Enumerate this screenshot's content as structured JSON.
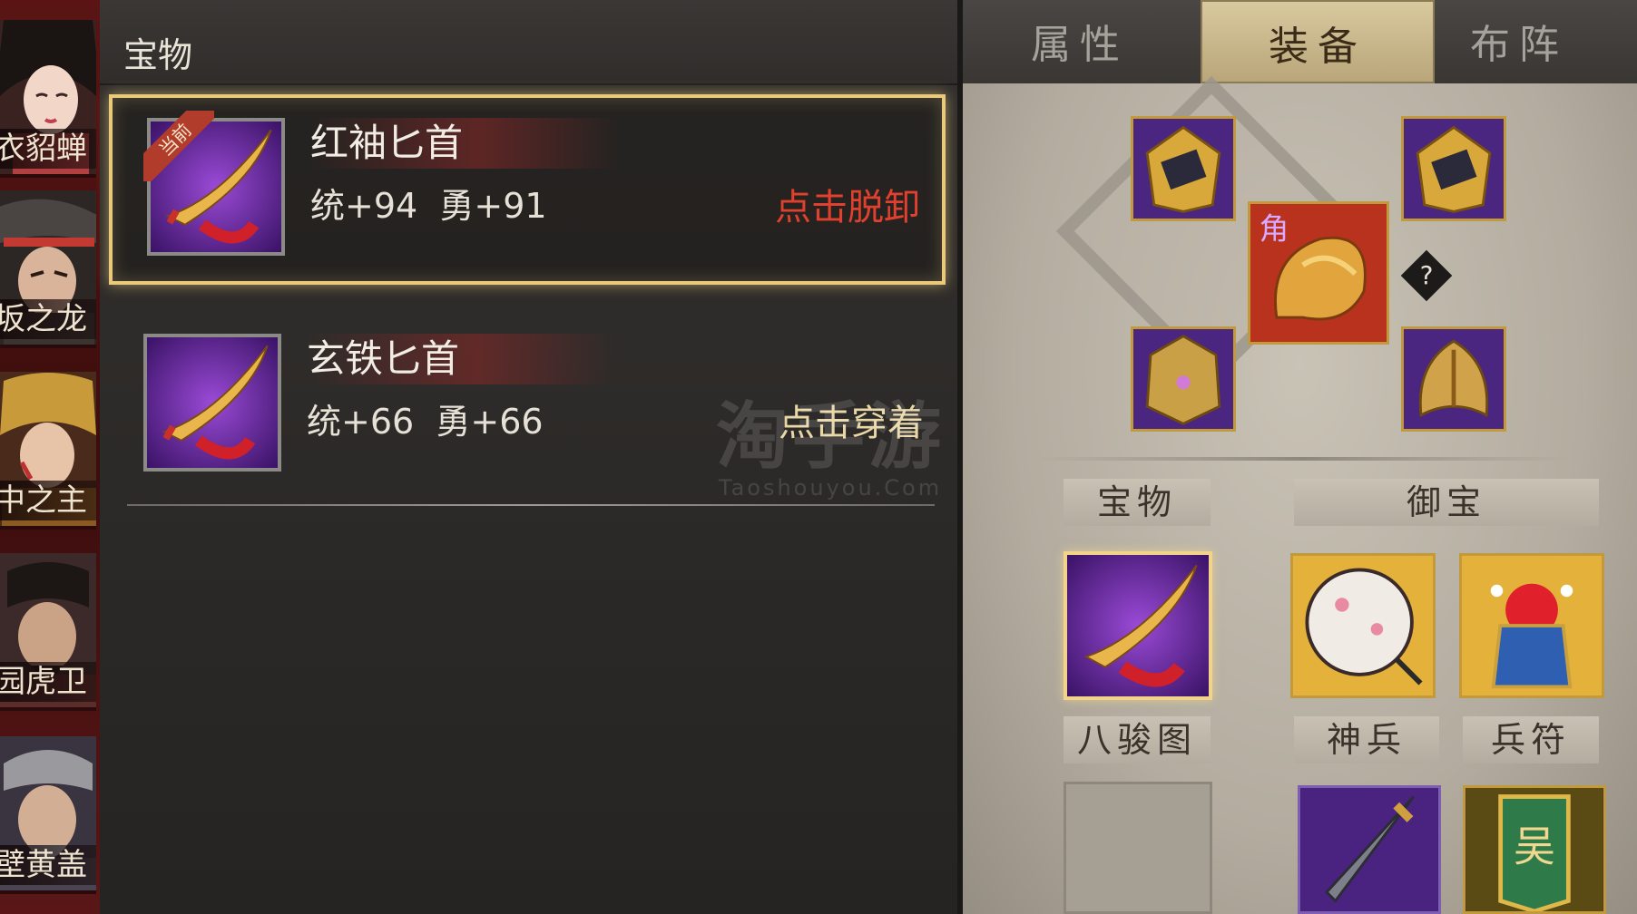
{
  "heroes": [
    {
      "name": "衣貂蝉"
    },
    {
      "name": "坂之龙"
    },
    {
      "name": "中之主"
    },
    {
      "name": "园虎卫"
    },
    {
      "name": "壁黄盖"
    }
  ],
  "treasure_list": {
    "title": "宝物",
    "items": [
      {
        "name": "红袖匕首",
        "stats": "统+94  勇+91",
        "badge": "当前",
        "action": "点击脱卸",
        "action_color": "#e0402e"
      },
      {
        "name": "玄铁匕首",
        "stats": "统+66  勇+66",
        "action": "点击穿着",
        "action_color": "#e8d7a6"
      }
    ]
  },
  "watermark": {
    "main": "淘手游",
    "sub": "Taoshouyou.Com"
  },
  "tabs": [
    {
      "label": "属性"
    },
    {
      "label": "装备",
      "active": true
    },
    {
      "label": "布阵"
    }
  ],
  "equipment": {
    "mount_mark": "角",
    "help_label": "?",
    "slot_labels": {
      "treasure": "宝物",
      "imperial_treasure": "御宝",
      "eight_horses": "八骏图",
      "divine_weapon": "神兵",
      "army_token": "兵符"
    },
    "token_mark": "吴"
  },
  "colors": {
    "accent_gold": "#e9c97a",
    "unequip_red": "#e0402e",
    "equip_gold": "#e8d7a6",
    "purple_slot": "#7d5eb0"
  }
}
